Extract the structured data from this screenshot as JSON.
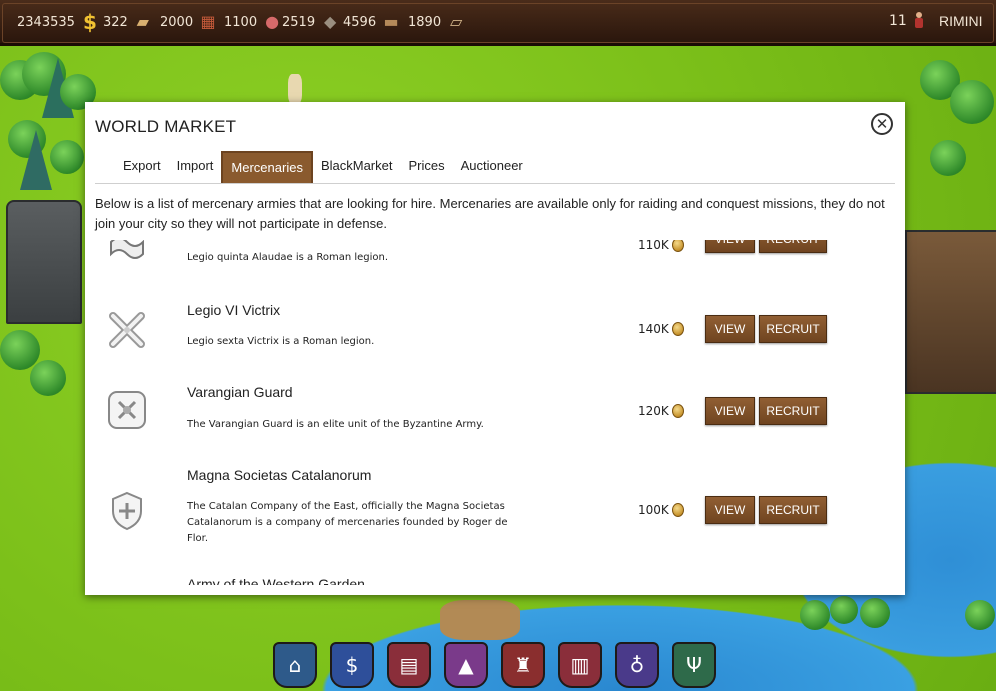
{
  "topbar": {
    "resources": [
      {
        "value": "2343535",
        "icon": "dollar-icon",
        "glyph": "$"
      },
      {
        "value": "322",
        "icon": "wood-icon",
        "glyph": "▰"
      },
      {
        "value": "2000",
        "icon": "brick-icon",
        "glyph": "▦"
      },
      {
        "value": "1100",
        "icon": "meat-icon",
        "glyph": "●"
      },
      {
        "value": "2519",
        "icon": "stone-icon",
        "glyph": "◆"
      },
      {
        "value": "4596",
        "icon": "log-icon",
        "glyph": "▬"
      },
      {
        "value": "1890",
        "icon": "plank-icon",
        "glyph": "▱"
      }
    ],
    "level": "11",
    "city": "RIMINI"
  },
  "modal": {
    "title": "WORLD MARKET",
    "close_glyph": "✕",
    "tabs": [
      {
        "label": "Export",
        "active": false
      },
      {
        "label": "Import",
        "active": false
      },
      {
        "label": "Mercenaries",
        "active": true
      },
      {
        "label": "BlackMarket",
        "active": false
      },
      {
        "label": "Prices",
        "active": false
      },
      {
        "label": "Auctioneer",
        "active": false
      }
    ],
    "description": "Below is a list of mercenary armies that are looking for hire. Mercenaries are available only for raiding and conquest missions, they do not join your city so they will not participate in defense.",
    "view_label": "VIEW",
    "recruit_label": "RECRUIT",
    "mercenaries": [
      {
        "name": "",
        "description": "Legio quinta Alaudae is a Roman legion.",
        "price": "110K",
        "emblem": "scroll-emblem-icon"
      },
      {
        "name": "Legio VI Victrix",
        "description": "Legio sexta Victrix is a Roman legion.",
        "price": "140K",
        "emblem": "crossed-axes-emblem-icon"
      },
      {
        "name": "Varangian Guard",
        "description": "The Varangian Guard is an elite unit of the Byzantine Army.",
        "price": "120K",
        "emblem": "ornate-tile-emblem-icon"
      },
      {
        "name": "Magna Societas Catalanorum",
        "description": "The Catalan Company of the East, officially the Magna Societas Catalanorum is a company of mercenaries founded by Roger de Flor.",
        "price": "100K",
        "emblem": "shield-emblem-icon"
      },
      {
        "name": "Army of the Western Garden",
        "description": "",
        "price": "",
        "emblem": ""
      }
    ]
  },
  "dock": [
    {
      "name": "town-hall-icon",
      "glyph": "⌂",
      "color": "#2e5a8a"
    },
    {
      "name": "bank-icon",
      "glyph": "$",
      "color": "#2e4f9a"
    },
    {
      "name": "market-icon",
      "glyph": "▤",
      "color": "#8a2e3a"
    },
    {
      "name": "academy-icon",
      "glyph": "▲",
      "color": "#7a3a8a"
    },
    {
      "name": "barracks-icon",
      "glyph": "♜",
      "color": "#8a2e2e"
    },
    {
      "name": "library-icon",
      "glyph": "▥",
      "color": "#8a2e3a"
    },
    {
      "name": "church-icon",
      "glyph": "♁",
      "color": "#4a3a8a"
    },
    {
      "name": "tavern-icon",
      "glyph": "Ψ",
      "color": "#2e6a4a"
    }
  ]
}
